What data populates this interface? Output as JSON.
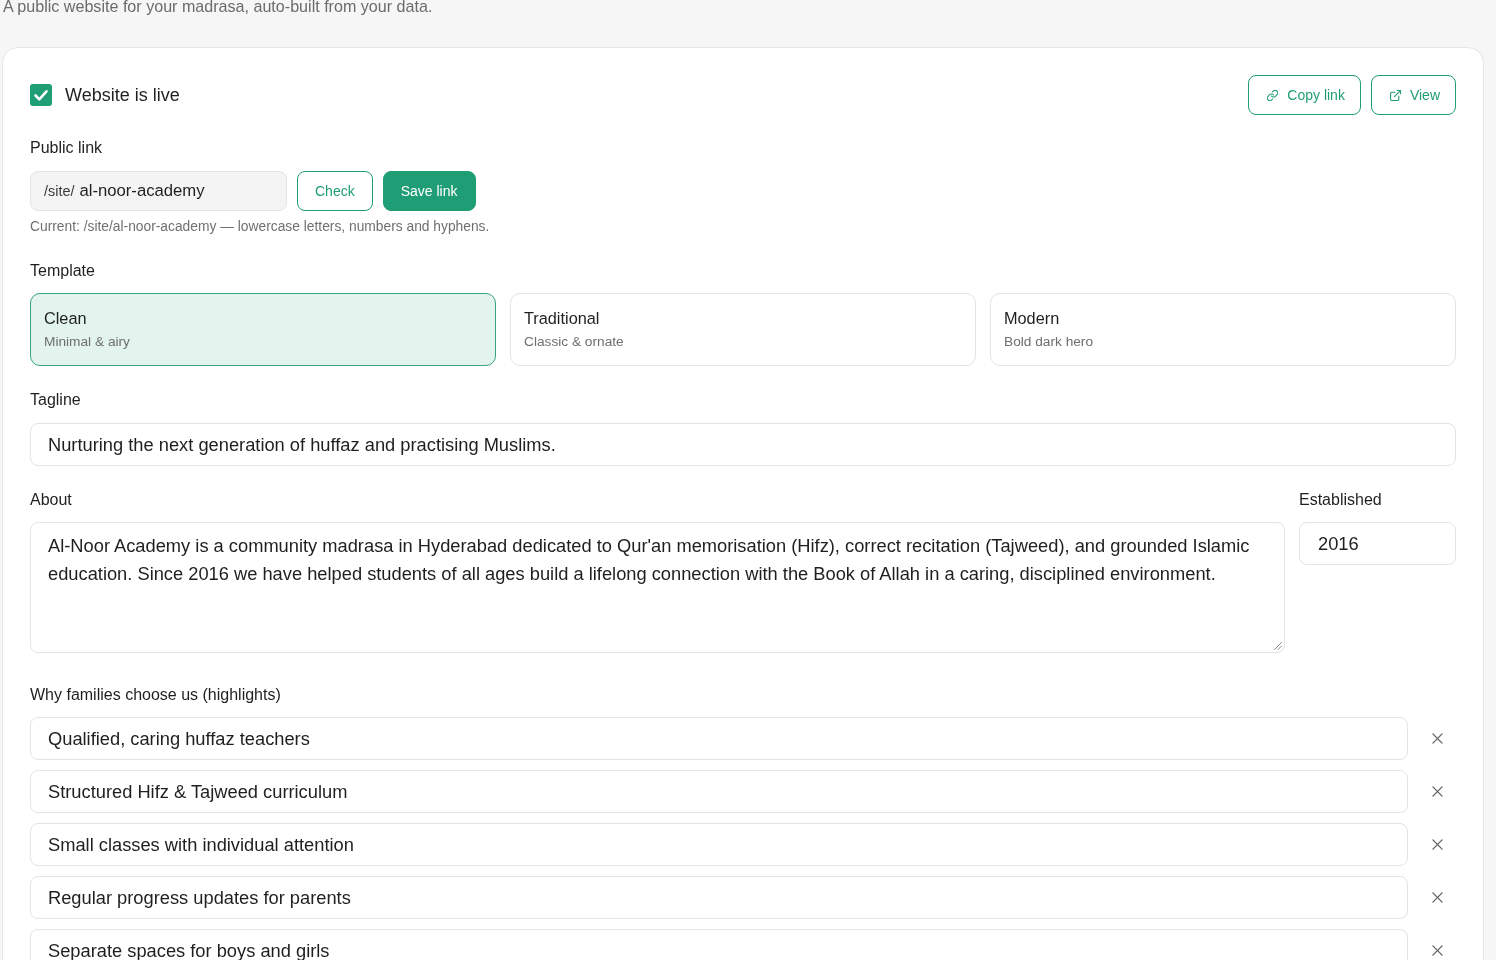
{
  "page": {
    "subtitle": "A public website for your madrasa, auto-built from your data."
  },
  "live_toggle": {
    "label": "Website is live",
    "checked": true
  },
  "actions": [
    {
      "kind": "copy",
      "label": "Copy link"
    },
    {
      "kind": "view",
      "label": "View"
    }
  ],
  "public_link": {
    "label": "Public link",
    "prefix": "/site/",
    "value": "al-noor-academy",
    "buttons": [
      {
        "kind": "outline",
        "label": "Check"
      },
      {
        "kind": "primary",
        "label": "Save link"
      }
    ],
    "hint": "Current: /site/al-noor-academy — lowercase letters, numbers and hyphens."
  },
  "template": {
    "label": "Template",
    "options": [
      {
        "title": "Clean",
        "description": "Minimal & airy",
        "selected": true
      },
      {
        "title": "Traditional",
        "description": "Classic & ornate",
        "selected": false
      },
      {
        "title": "Modern",
        "description": "Bold dark hero",
        "selected": false
      }
    ]
  },
  "tagline": {
    "label": "Tagline",
    "value": "Nurturing the next generation of huffaz and practising Muslims."
  },
  "about": {
    "label": "About",
    "value": "Al-Noor Academy is a community madrasa in Hyderabad dedicated to Qur'an memorisation (Hifz), correct recitation (Tajweed), and grounded Islamic education. Since 2016 we have helped students of all ages build a lifelong connection with the Book of Allah in a caring, disciplined environment."
  },
  "established": {
    "label": "Established",
    "value": "2016"
  },
  "highlights": {
    "label": "Why families choose us (highlights)",
    "items": [
      {
        "value": "Qualified, caring huffaz teachers"
      },
      {
        "value": "Structured Hifz & Tajweed curriculum"
      },
      {
        "value": "Small classes with individual attention"
      },
      {
        "value": "Regular progress updates for parents"
      },
      {
        "value": "Separate spaces for boys and girls"
      }
    ]
  }
}
